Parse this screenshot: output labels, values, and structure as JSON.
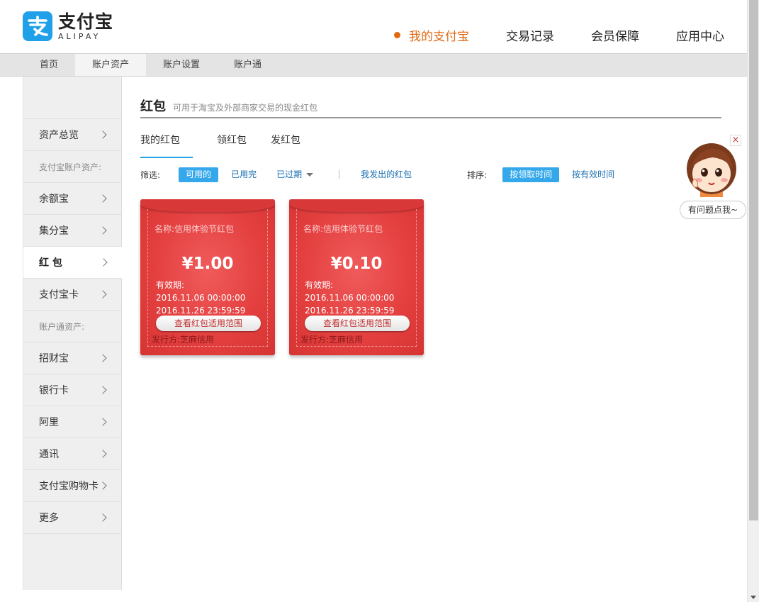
{
  "header": {
    "logo_cn": "支付宝",
    "logo_en": "ALIPAY",
    "nav": [
      {
        "label": "我的支付宝",
        "active": true
      },
      {
        "label": "交易记录"
      },
      {
        "label": "会员保障"
      },
      {
        "label": "应用中心"
      }
    ],
    "accent_color": "#e06a13"
  },
  "subnav": [
    "首页",
    "账户资产",
    "账户设置",
    "账户通"
  ],
  "sidebar": {
    "item_overview": "资产总览",
    "group_alipay": "支付宝账户资产:",
    "item_yuebao": "余额宝",
    "item_jifenbao": "集分宝",
    "item_hongbao": "红 包",
    "item_alipay_card": "支付宝卡",
    "group_zhanghutong": "账户通资产:",
    "item_zhaocaibao": "招财宝",
    "item_bank_card": "银行卡",
    "item_ali": "阿里",
    "item_tongxun": "通讯",
    "item_shopping_card": "支付宝购物卡",
    "item_more": "更多"
  },
  "main": {
    "title": "红包",
    "subtitle": "可用于淘宝及外部商家交易的现金红包",
    "tabs": [
      "我的红包",
      "领红包",
      "发红包"
    ],
    "filter": {
      "label": "筛选:",
      "options": [
        "可用的",
        "已用完",
        "已过期"
      ],
      "my_sent": "我发出的红包"
    },
    "sort": {
      "label": "排序:",
      "options": [
        "按领取时间",
        "按有效时间"
      ]
    },
    "packets": [
      {
        "name": "名称:信用体验节红包",
        "amount": "¥1.00",
        "valid_label": "有效期:",
        "valid_from": "2016.11.06 00:00:00",
        "valid_to": "2016.11.26 23:59:59",
        "button": "查看红包适用范围",
        "issuer": "发行方:芝麻信用"
      },
      {
        "name": "名称:信用体验节红包",
        "amount": "¥0.10",
        "valid_label": "有效期:",
        "valid_from": "2016.11.06 00:00:00",
        "valid_to": "2016.11.26 23:59:59",
        "button": "查看红包适用范围",
        "issuer": "发行方:芝麻信用"
      }
    ]
  },
  "help": {
    "close": "×",
    "bubble": "有问题点我~"
  }
}
